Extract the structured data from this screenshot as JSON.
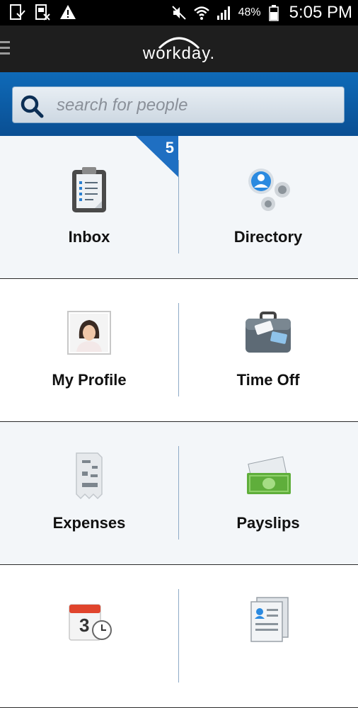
{
  "status_bar": {
    "battery_percent": "48%",
    "time": "5:05 PM"
  },
  "app": {
    "logo_text": "workday."
  },
  "search": {
    "placeholder": "search for people"
  },
  "tiles": [
    {
      "label": "Inbox",
      "badge": "5"
    },
    {
      "label": "Directory"
    },
    {
      "label": "My Profile"
    },
    {
      "label": "Time Off"
    },
    {
      "label": "Expenses"
    },
    {
      "label": "Payslips"
    },
    {
      "label": ""
    },
    {
      "label": ""
    }
  ],
  "calendar_icon": {
    "day": "3"
  }
}
